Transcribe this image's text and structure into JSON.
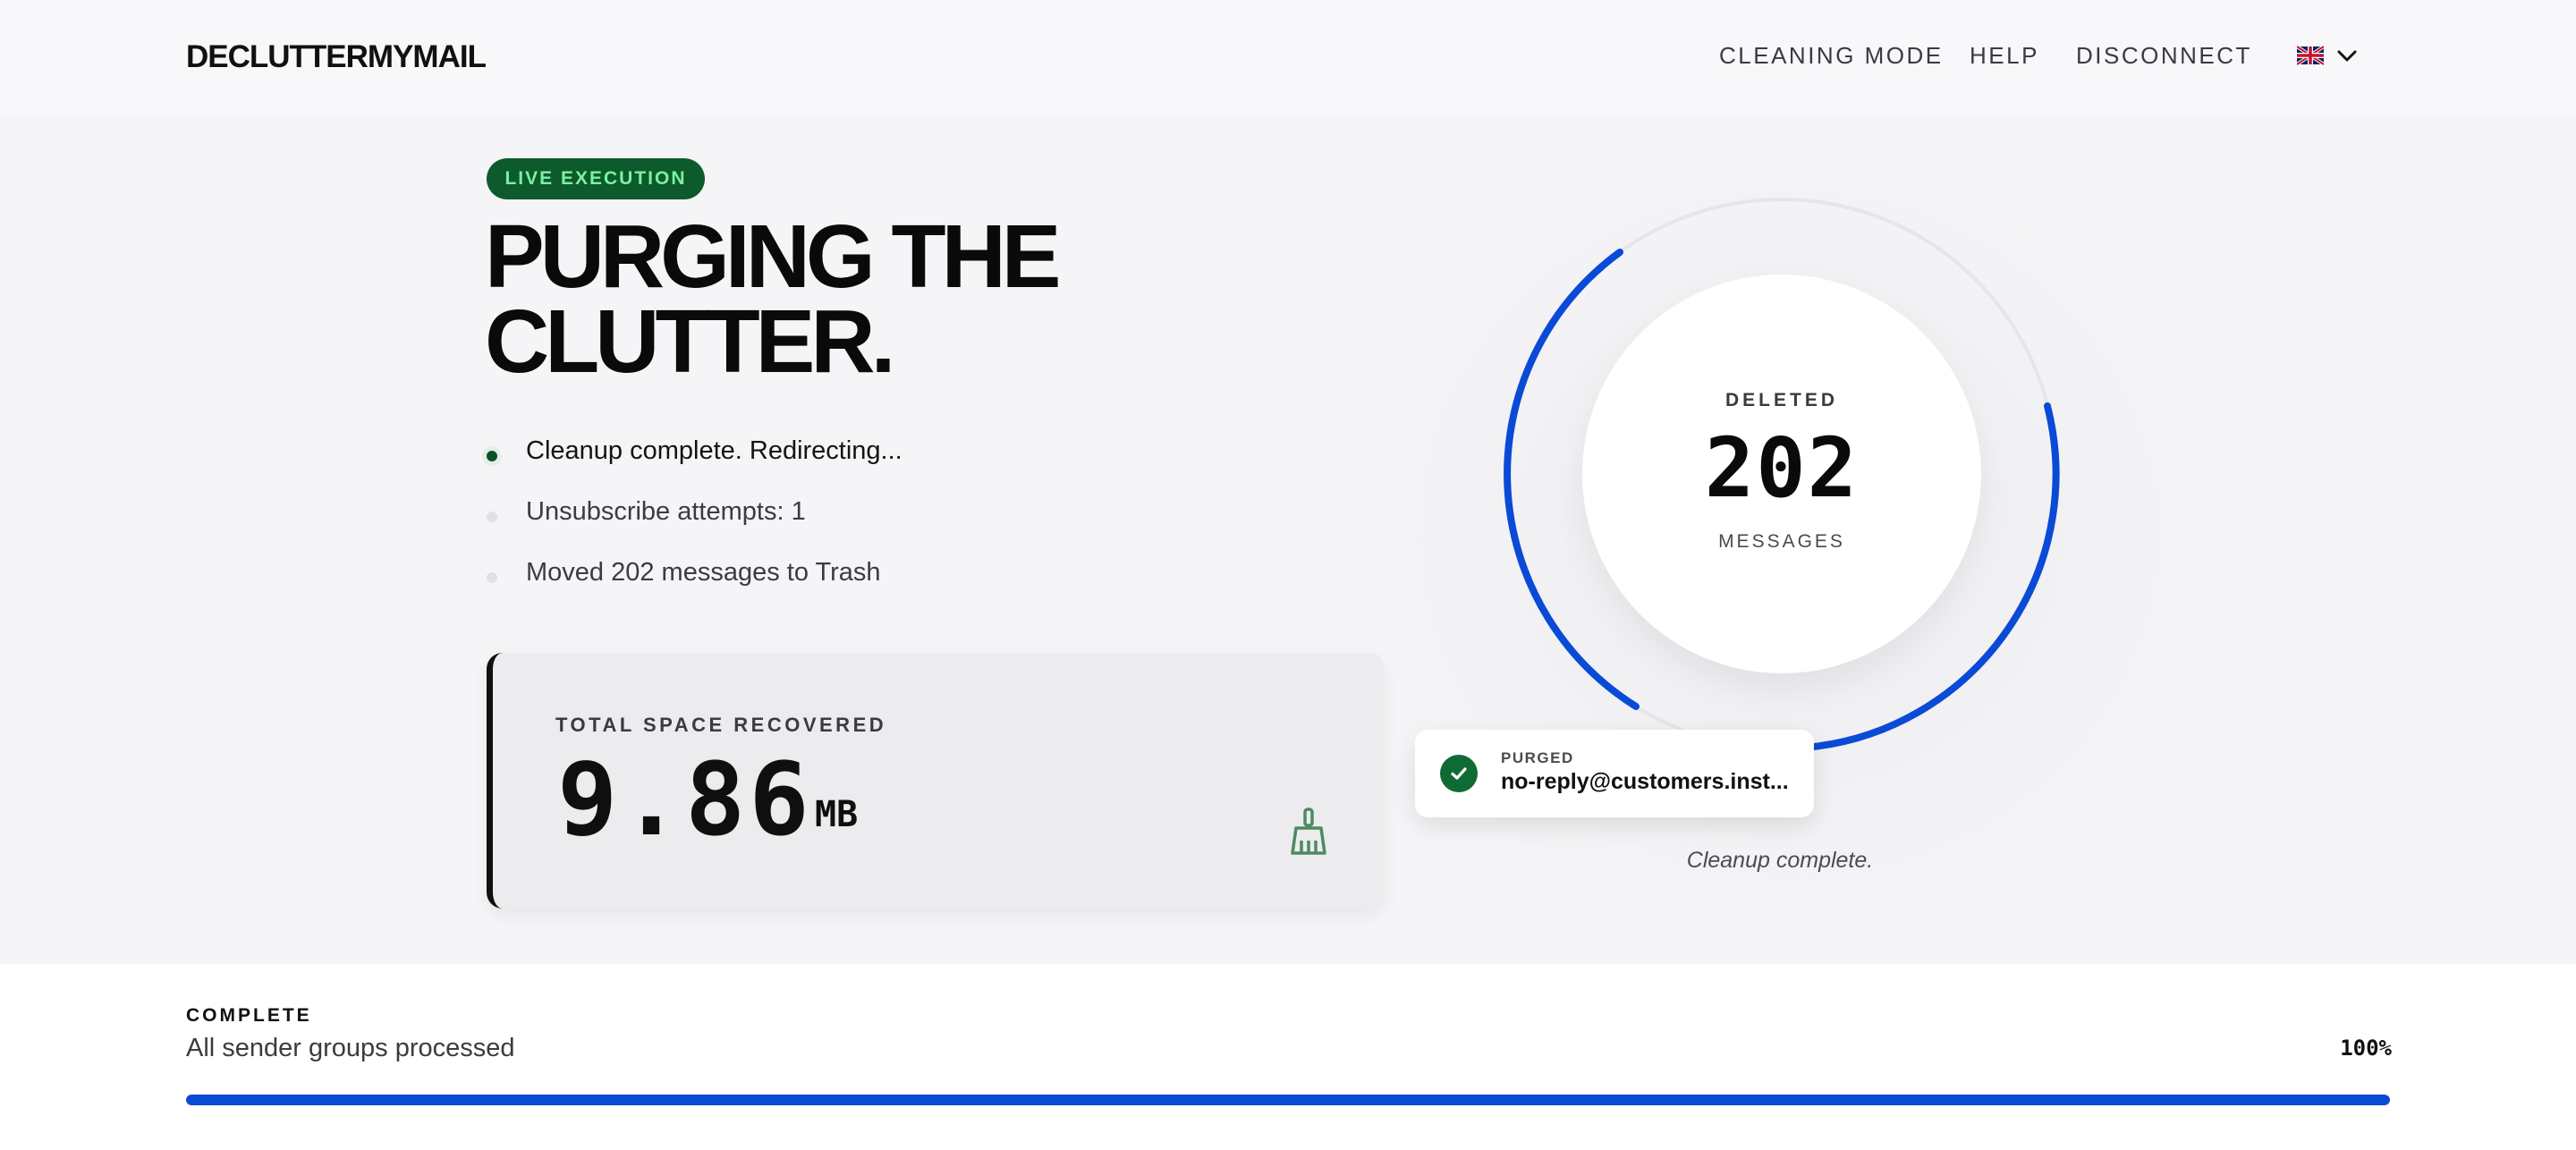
{
  "header": {
    "brand": "DECLUTTERMYMAIL",
    "nav": [
      "CLEANING MODE",
      "HELP",
      "DISCONNECT"
    ],
    "language_icon": "uk-flag-icon"
  },
  "hero": {
    "badge": "LIVE EXECUTION",
    "title_line1": "PURGING THE",
    "title_line2": "CLUTTER.",
    "log": [
      "Cleanup complete. Redirecting...",
      "Unsubscribe attempts: 1",
      "Moved 202 messages to Trash"
    ],
    "space": {
      "label": "TOTAL SPACE RECOVERED",
      "value": "9.86",
      "unit": "MB"
    },
    "counter": {
      "label": "DELETED",
      "count": "202",
      "unit": "MESSAGES"
    },
    "toast": {
      "label": "PURGED",
      "email": "no-reply@customers.inst..."
    },
    "note": "Cleanup complete."
  },
  "progress": {
    "label": "COMPLETE",
    "text": "All sender groups processed",
    "percent_text": "100%",
    "percent": 100
  },
  "colors": {
    "accent": "#0a4ad6",
    "badge_bg": "#0d5a2c",
    "badge_text": "#7cf0a4",
    "success": "#0f6b34"
  }
}
